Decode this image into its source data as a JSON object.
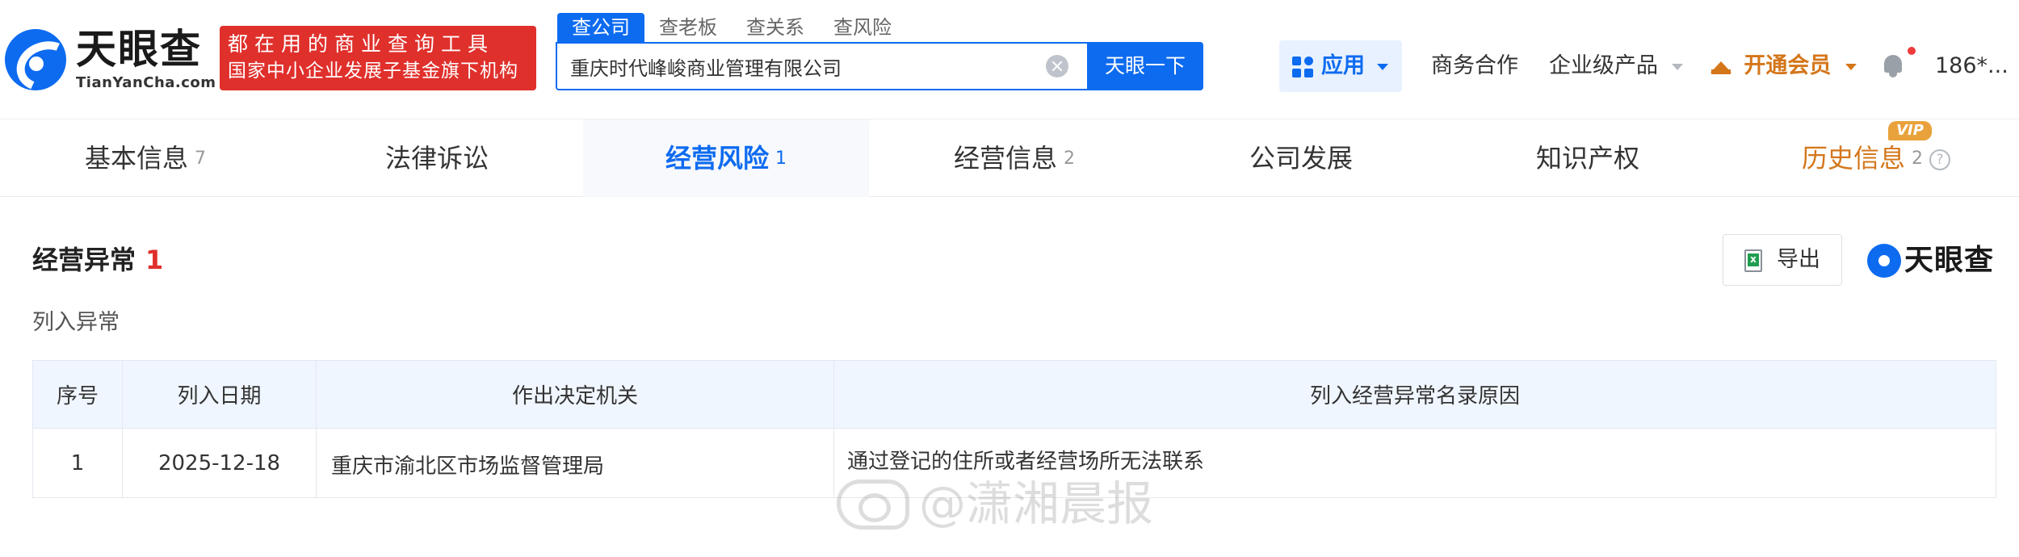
{
  "brand": {
    "name_cn": "天眼查",
    "name_en": "TianYanCha.com",
    "accent_color": "#0d6bf0"
  },
  "promo": {
    "line1": "都在用的商业查询工具",
    "line2": "国家中小企业发展子基金旗下机构",
    "color": "#e0302c"
  },
  "search": {
    "tabs": [
      "查公司",
      "查老板",
      "查关系",
      "查风险"
    ],
    "active_tab": "查公司",
    "query": "重庆时代峰峻商业管理有限公司",
    "button_label": "天眼一下"
  },
  "nav": {
    "app_label": "应用",
    "business": "商务合作",
    "enterprise": "企业级产品",
    "vip": "开通会员",
    "user": "186*..."
  },
  "tabs": [
    {
      "label": "基本信息",
      "count": "7"
    },
    {
      "label": "法律诉讼",
      "count": ""
    },
    {
      "label": "经营风险",
      "count": "1"
    },
    {
      "label": "经营信息",
      "count": "2"
    },
    {
      "label": "公司发展",
      "count": ""
    },
    {
      "label": "知识产权",
      "count": ""
    },
    {
      "label": "历史信息",
      "count": "2"
    }
  ],
  "active_tab": "经营风险",
  "vip_badge": "VIP",
  "section": {
    "title": "经营异常",
    "count": "1",
    "export_label": "导出",
    "subtitle": "列入异常",
    "logo_text": "天眼查"
  },
  "table": {
    "headers": [
      "序号",
      "列入日期",
      "作出决定机关",
      "列入经营异常名录原因"
    ],
    "rows": [
      {
        "no": "1",
        "date": "2025-12-18",
        "authority": "重庆市渝北区市场监督管理局",
        "reason": "通过登记的住所或者经营场所无法联系"
      }
    ]
  },
  "watermark": {
    "text": "@潇湘晨报"
  }
}
